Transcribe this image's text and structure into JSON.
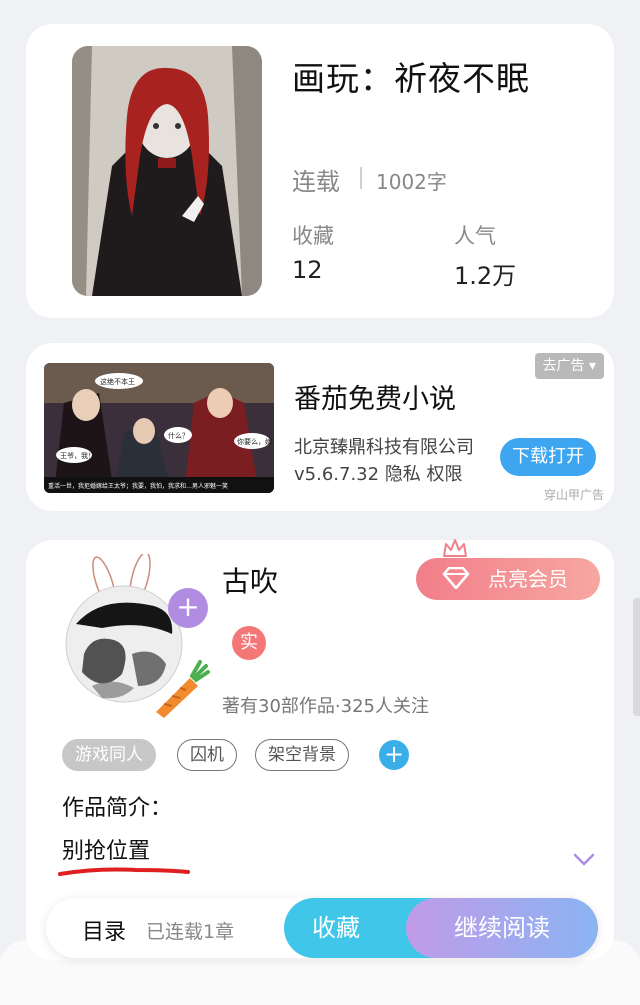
{
  "book": {
    "title": "画玩：祈夜不眠",
    "status": "连载",
    "word_count": "1002字",
    "favorites_label": "收藏",
    "favorites_value": "12",
    "popularity_label": "人气",
    "popularity_value": "1.2万"
  },
  "ad": {
    "remove_label": "去广告",
    "title": "番茄免费小说",
    "company": "北京臻鼎科技有限公司",
    "version": "v5.6.7.32",
    "privacy": "隐私",
    "permissions": "权限",
    "download_label": "下载打开",
    "source": "穿山甲广告",
    "banner_caption": "重活一世，我拒婚嫁给王太爷；我要，我怕，我求和…男人邪魅一笑",
    "bubble_1": "这绝不本王",
    "bubble_2": "王爷，我！",
    "bubble_3": "什么？",
    "bubble_4": "你要么，嫁！"
  },
  "author": {
    "name": "古吹",
    "verified": "实",
    "stats": "著有30部作品·325人关注",
    "vip_label": "点亮会员",
    "tags": [
      "游戏同人",
      "囚机",
      "架空背景"
    ],
    "add_tag": "+",
    "avatar_add": "+",
    "intro_label": "作品简介：",
    "intro_text": "别抢位置"
  },
  "bottom_bar": {
    "toc_label": "目录",
    "chapters": "已连载1章",
    "favorite_label": "收藏",
    "read_label": "继续阅读"
  },
  "colors": {
    "accent_blue": "#3ea6f0",
    "vip_pink": "#f27e8a",
    "favorite_cyan": "#3fc6e8",
    "read_purple": "#c09be8",
    "underline_red": "#e02020"
  }
}
